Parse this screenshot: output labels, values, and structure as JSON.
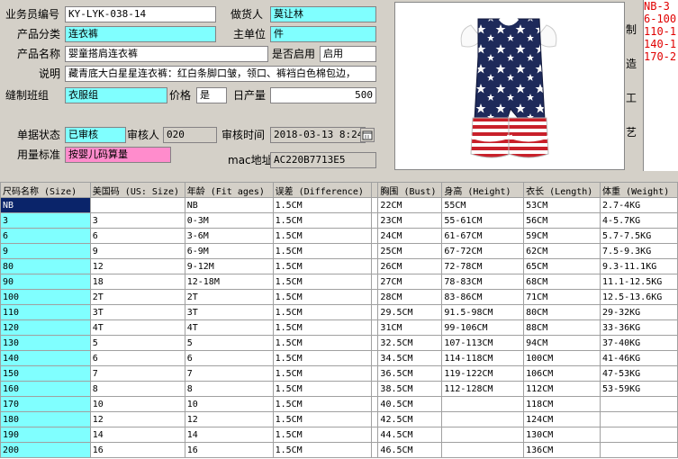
{
  "form": {
    "salesperson_label": "业务员编号",
    "salesperson_value": "KY-LYK-038-14",
    "merchandiser_label": "做货人",
    "merchandiser_value": "莫让林",
    "category_label": "产品分类",
    "category_value": "连衣裤",
    "unit_label": "主单位",
    "unit_value": "件",
    "name_label": "产品名称",
    "name_value": "婴童搭肩连衣裤",
    "enabled_label": "是否启用",
    "enabled_value": "启用",
    "desc_label": "说明",
    "desc_value": "藏青底大白星星连衣裤：红白条脚口皱，领口、裤裆白色棉包边，",
    "team_label": "缝制班组",
    "team_value": "衣服组",
    "price_label": "价格",
    "price_value": "是",
    "daily_label": "日产量",
    "daily_value": "500",
    "status_label": "单据状态",
    "status_value": "已审核",
    "reviewer_label": "审核人",
    "reviewer_value": "020",
    "review_time_label": "审核时间",
    "review_time_value": "2018-03-13   8:24",
    "standard_label": "用量标准",
    "standard_value": "按婴儿码算量",
    "mac_label": "mac地址",
    "mac_value": "AC220B7713E5"
  },
  "process_label": [
    "制",
    "造",
    "工",
    "艺"
  ],
  "process_text": [
    "NB-3",
    "6-100",
    "110-1",
    "140-1",
    "170-2"
  ],
  "table": {
    "headers": [
      "尺码名称 (Size)",
      "美国码 (US: Size)",
      "年龄 (Fit ages)",
      "误差 (Difference)",
      "",
      "胸围 (Bust)",
      "身高 (Height)",
      "衣长 (Length)",
      "体重 (Weight)"
    ],
    "rows": [
      [
        "NB",
        "",
        "NB",
        "1.5CM",
        "",
        "22CM",
        "55CM",
        "53CM",
        "2.7-4KG"
      ],
      [
        "3",
        "3",
        "0-3M",
        "1.5CM",
        "",
        "23CM",
        "55-61CM",
        "56CM",
        "4-5.7KG"
      ],
      [
        "6",
        "6",
        "3-6M",
        "1.5CM",
        "",
        "24CM",
        "61-67CM",
        "59CM",
        "5.7-7.5KG"
      ],
      [
        "9",
        "9",
        "6-9M",
        "1.5CM",
        "",
        "25CM",
        "67-72CM",
        "62CM",
        "7.5-9.3KG"
      ],
      [
        "80",
        "12",
        "9-12M",
        "1.5CM",
        "",
        "26CM",
        "72-78CM",
        "65CM",
        "9.3-11.1KG"
      ],
      [
        "90",
        "18",
        "12-18M",
        "1.5CM",
        "",
        "27CM",
        "78-83CM",
        "68CM",
        "11.1-12.5KG"
      ],
      [
        "100",
        "2T",
        "2T",
        "1.5CM",
        "",
        "28CM",
        "83-86CM",
        "71CM",
        "12.5-13.6KG"
      ],
      [
        "110",
        "3T",
        "3T",
        "1.5CM",
        "",
        "29.5CM",
        "91.5-98CM",
        "80CM",
        "29-32KG"
      ],
      [
        "120",
        "4T",
        "4T",
        "1.5CM",
        "",
        "31CM",
        "99-106CM",
        "88CM",
        "33-36KG"
      ],
      [
        "130",
        "5",
        "5",
        "1.5CM",
        "",
        "32.5CM",
        "107-113CM",
        "94CM",
        "37-40KG"
      ],
      [
        "140",
        "6",
        "6",
        "1.5CM",
        "",
        "34.5CM",
        "114-118CM",
        "100CM",
        "41-46KG"
      ],
      [
        "150",
        "7",
        "7",
        "1.5CM",
        "",
        "36.5CM",
        "119-122CM",
        "106CM",
        "47-53KG"
      ],
      [
        "160",
        "8",
        "8",
        "1.5CM",
        "",
        "38.5CM",
        "112-128CM",
        "112CM",
        "53-59KG"
      ],
      [
        "170",
        "10",
        "10",
        "1.5CM",
        "",
        "40.5CM",
        "",
        "118CM",
        ""
      ],
      [
        "180",
        "12",
        "12",
        "1.5CM",
        "",
        "42.5CM",
        "",
        "124CM",
        ""
      ],
      [
        "190",
        "14",
        "14",
        "1.5CM",
        "",
        "44.5CM",
        "",
        "130CM",
        ""
      ],
      [
        "200",
        "16",
        "16",
        "1.5CM",
        "",
        "46.5CM",
        "",
        "136CM",
        ""
      ]
    ]
  },
  "colors": {
    "field_cyan": "#80ffff",
    "field_pink": "#ff8ccc",
    "window_gray": "#d4d0c8",
    "process_red": "#e00000"
  }
}
